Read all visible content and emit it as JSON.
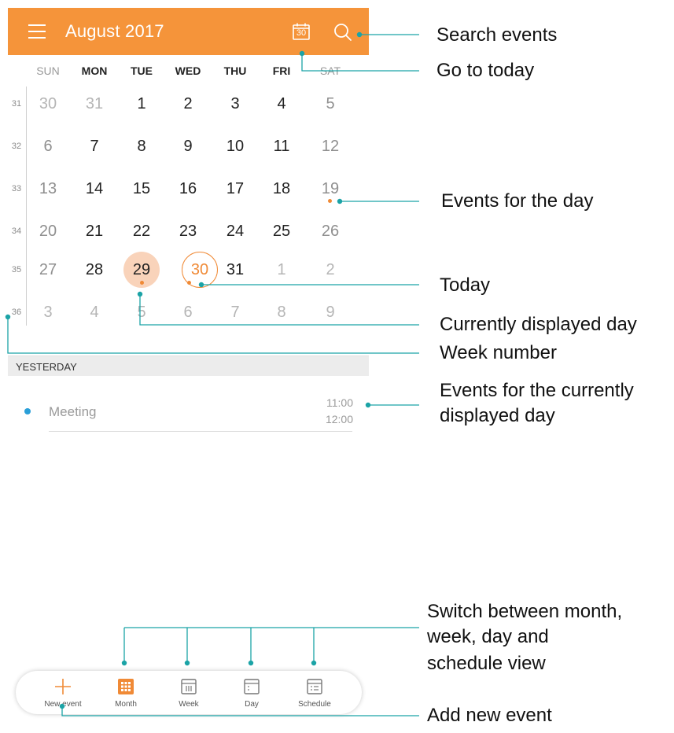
{
  "header": {
    "title": "August 2017",
    "today_icon_number": "30",
    "icons": [
      "menu-icon",
      "calendar-today-icon",
      "search-icon"
    ],
    "accent_color": "#f5943a"
  },
  "weekdays": [
    "SUN",
    "MON",
    "TUE",
    "WED",
    "THU",
    "FRI",
    "SAT"
  ],
  "weeks": [
    {
      "number": "31",
      "days": [
        "30",
        "31",
        "1",
        "2",
        "3",
        "4",
        "5"
      ]
    },
    {
      "number": "32",
      "days": [
        "6",
        "7",
        "8",
        "9",
        "10",
        "11",
        "12"
      ]
    },
    {
      "number": "33",
      "days": [
        "13",
        "14",
        "15",
        "16",
        "17",
        "18",
        "19"
      ]
    },
    {
      "number": "34",
      "days": [
        "20",
        "21",
        "22",
        "23",
        "24",
        "25",
        "26"
      ]
    },
    {
      "number": "35",
      "days": [
        "27",
        "28",
        "29",
        "30",
        "31",
        "1",
        "2"
      ]
    },
    {
      "number": "36",
      "days": [
        "3",
        "4",
        "5",
        "6",
        "7",
        "8",
        "9"
      ]
    }
  ],
  "selected_day": "29",
  "today": "30",
  "days_with_events": [
    "19",
    "29",
    "30"
  ],
  "events_section": {
    "label": "YESTERDAY",
    "events": [
      {
        "title": "Meeting",
        "start": "11:00",
        "end": "12:00",
        "color": "#2a9fd8"
      }
    ]
  },
  "bottom_nav": {
    "items": [
      {
        "label": "New event",
        "icon": "plus-icon"
      },
      {
        "label": "Month",
        "icon": "month-grid-icon",
        "active": true
      },
      {
        "label": "Week",
        "icon": "week-view-icon"
      },
      {
        "label": "Day",
        "icon": "day-view-icon"
      },
      {
        "label": "Schedule",
        "icon": "schedule-list-icon"
      }
    ]
  },
  "callouts": {
    "search_events": "Search events",
    "go_to_today": "Go to today",
    "events_for_day": "Events for the day",
    "today": "Today",
    "currently_displayed_day": "Currently displayed day",
    "week_number": "Week number",
    "events_current_day_line1": "Events for the currently",
    "events_current_day_line2": "displayed day",
    "switch_view_line1": "Switch between month,",
    "switch_view_line2": "week, day and",
    "switch_view_line3": "schedule view",
    "add_new_event": "Add new event",
    "line_color": "#1ba3a6"
  }
}
